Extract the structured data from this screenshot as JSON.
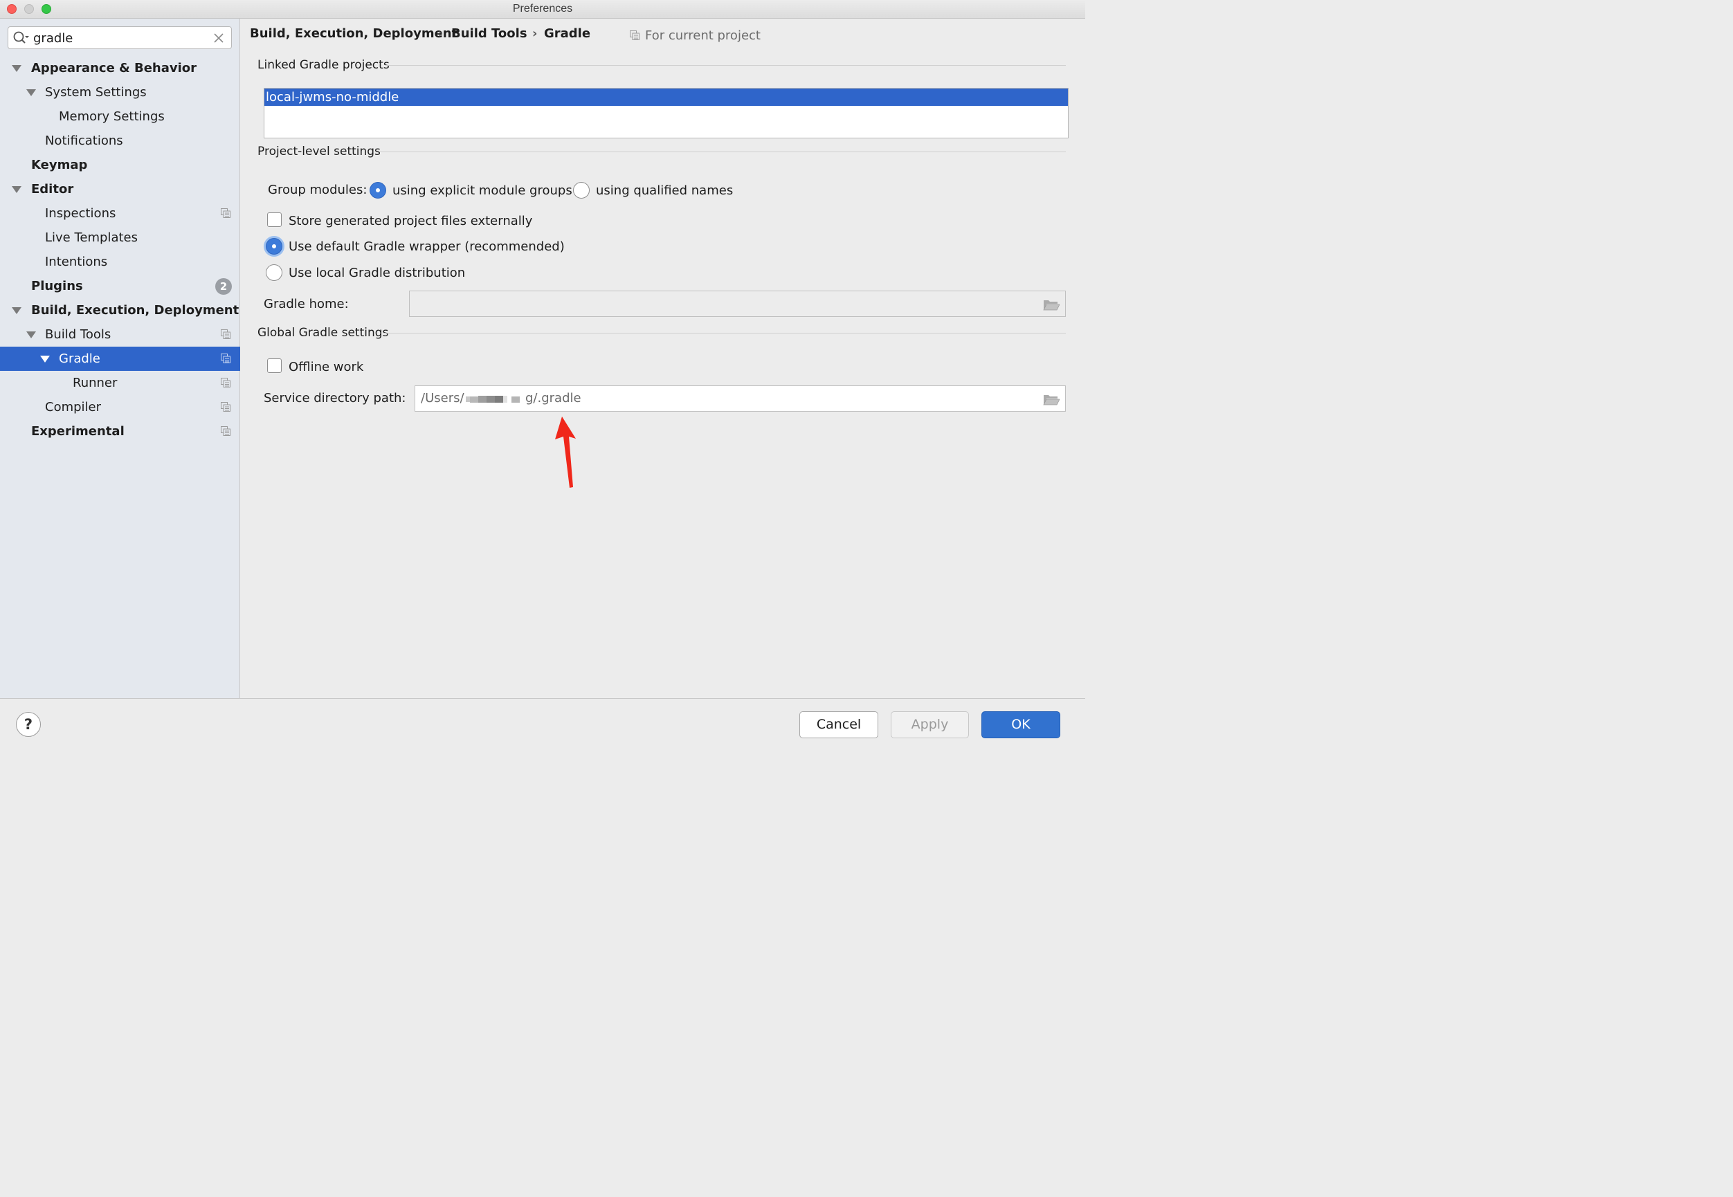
{
  "window": {
    "title": "Preferences"
  },
  "search": {
    "value": "gradle"
  },
  "sidebar": {
    "items": [
      {
        "label": "Appearance & Behavior",
        "expanded": true
      },
      {
        "label": "System Settings",
        "expanded": true
      },
      {
        "label": "Memory Settings"
      },
      {
        "label": "Notifications"
      },
      {
        "label": "Keymap"
      },
      {
        "label": "Editor",
        "expanded": true
      },
      {
        "label": "Inspections"
      },
      {
        "label": "Live Templates"
      },
      {
        "label": "Intentions"
      },
      {
        "label": "Plugins",
        "badge": "2"
      },
      {
        "label": "Build, Execution, Deployment",
        "expanded": true
      },
      {
        "label": "Build Tools",
        "expanded": true
      },
      {
        "label": "Gradle",
        "expanded": true,
        "selected": true
      },
      {
        "label": "Runner"
      },
      {
        "label": "Compiler"
      },
      {
        "label": "Experimental"
      }
    ]
  },
  "breadcrumb": {
    "items": [
      "Build, Execution, Deployment",
      "Build Tools",
      "Gradle"
    ],
    "separator": "›"
  },
  "scope": {
    "label": "For current project"
  },
  "linked": {
    "title": "Linked Gradle projects",
    "projects": [
      "local-jwms-no-middle"
    ]
  },
  "project_level": {
    "title": "Project-level settings",
    "group_modules_label": "Group modules:",
    "group_option_explicit": "using explicit module groups",
    "group_option_qualified": "using qualified names",
    "group_selected": "using explicit module groups",
    "store_externally": "Store generated project files externally",
    "store_externally_checked": false,
    "use_default_wrapper": "Use default Gradle wrapper (recommended)",
    "use_local_distribution": "Use local Gradle distribution",
    "distribution_selected": "Use default Gradle wrapper (recommended)",
    "gradle_home_label": "Gradle home:",
    "gradle_home_value": ""
  },
  "global": {
    "title": "Global Gradle settings",
    "offline_work": "Offline work",
    "offline_work_checked": false,
    "service_dir_label": "Service directory path:",
    "service_dir_prefix": "/Users/",
    "service_dir_suffix": "g/.gradle"
  },
  "buttons": {
    "cancel": "Cancel",
    "apply": "Apply",
    "ok": "OK",
    "help": "?"
  },
  "colors": {
    "selection": "#2f65ca",
    "ok_button": "#3272cf",
    "annotation_arrow": "#f0271a"
  },
  "icons": {
    "search": "search-icon",
    "clear": "close-icon",
    "project_scope": "project-scope-icon",
    "folder": "folder-icon"
  }
}
